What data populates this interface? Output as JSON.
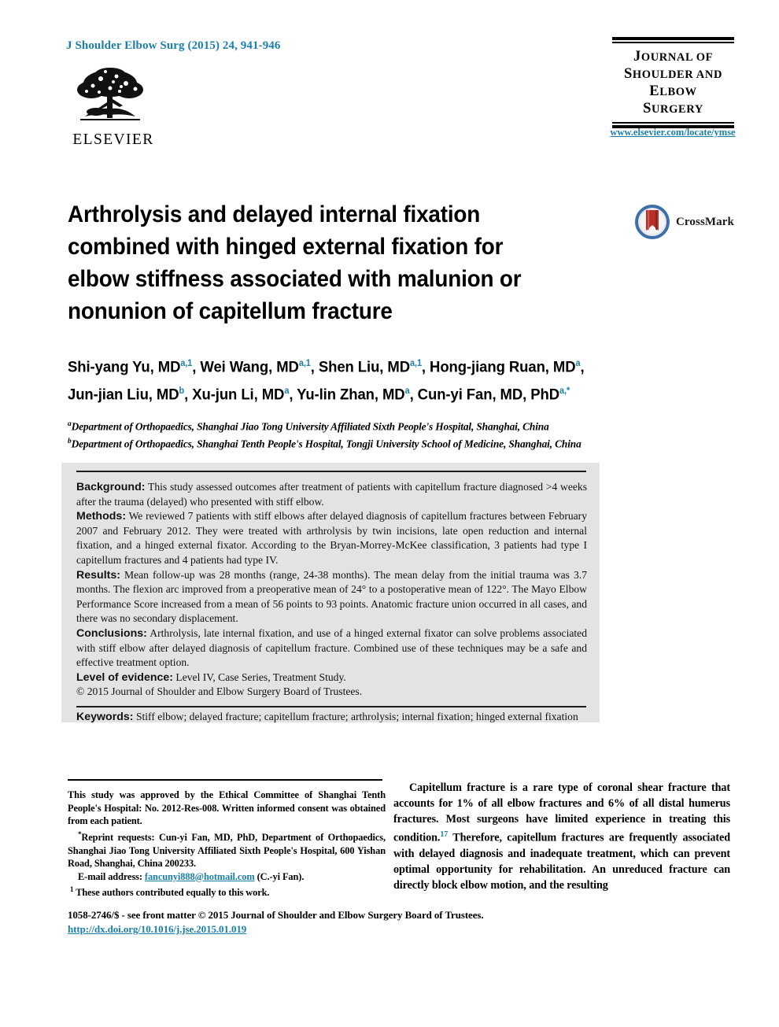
{
  "header": {
    "journal_reference": "J Shoulder Elbow Surg (2015) 24, 941-946",
    "publisher_name": "ELSEVIER",
    "publisher_logo": "elsevier-tree-logo",
    "masthead": {
      "line1_small": "OURNAL OF",
      "line1_cap": "J",
      "line2_cap": "S",
      "line2_small": "HOULDER AND",
      "line3_cap": "E",
      "line3_small": "LBOW",
      "line4_cap": "S",
      "line4_small": "URGERY"
    },
    "journal_url": "www.elsevier.com/locate/ymse"
  },
  "article": {
    "title": "Arthrolysis and delayed internal fixation combined with hinged external fixation for elbow stiffness associated with malunion or nonunion of capitellum fracture",
    "crossmark_label": "CrossMark",
    "authors_line1_html": "Shi-yang Yu, MD<sup>a,1</sup>, Wei Wang, MD<sup>a,1</sup>, Shen Liu, MD<sup>a,1</sup>, Hong-jiang Ruan, MD<sup>a</sup>,",
    "authors_line2_html": "Jun-jian Liu, MD<sup>b</sup>, Xu-jun Li, MD<sup>a</sup>, Yu-lin Zhan, MD<sup>a</sup>, Cun-yi Fan, MD, PhD<sup>a,</sup><sup>*</sup>",
    "affiliation_a": "Department of Orthopaedics, Shanghai Jiao Tong University Affiliated Sixth People's Hospital, Shanghai, China",
    "affiliation_b": "Department of Orthopaedics, Shanghai Tenth People's Hospital, Tongji University School of Medicine, Shanghai, China",
    "affiliation_a_marker": "a",
    "affiliation_b_marker": "b"
  },
  "abstract": {
    "background_label": "Background:",
    "background_text": "This study assessed outcomes after treatment of patients with capitellum fracture diagnosed >4 weeks after the trauma (delayed) who presented with stiff elbow.",
    "methods_label": "Methods:",
    "methods_text": "We reviewed 7 patients with stiff elbows after delayed diagnosis of capitellum fractures between February 2007 and February 2012. They were treated with arthrolysis by twin incisions, late open reduction and internal fixation, and a hinged external fixator. According to the Bryan-Morrey-McKee classification, 3 patients had type I capitellum fractures and 4 patients had type IV.",
    "results_label": "Results:",
    "results_text": "Mean follow-up was 28 months (range, 24-38 months). The mean delay from the initial trauma was 3.7 months. The flexion arc improved from a preoperative mean of 24° to a postoperative mean of 122°. The Mayo Elbow Performance Score increased from a mean of 56 points to 93 points. Anatomic fracture union occurred in all cases, and there was no secondary displacement.",
    "conclusions_label": "Conclusions:",
    "conclusions_text": "Arthrolysis, late internal fixation, and use of a hinged external fixator can solve problems associated with stiff elbow after delayed diagnosis of capitellum fracture. Combined use of these techniques may be a safe and effective treatment option.",
    "level_label": "Level of evidence:",
    "level_text": "Level IV, Case Series, Treatment Study.",
    "copyright": "© 2015 Journal of Shoulder and Elbow Surgery Board of Trustees.",
    "keywords_label": "Keywords:",
    "keywords_text": "Stiff elbow; delayed fracture; capitellum fracture; arthrolysis; internal fixation; hinged external fixation"
  },
  "footnotes": {
    "ethics": "This study was approved by the Ethical Committee of Shanghai Tenth People's Hospital: No. 2012-Res-008. Written informed consent was obtained from each patient.",
    "reprint_marker": "*",
    "reprint": "Reprint requests: Cun-yi Fan, MD, PhD, Department of Orthopaedics, Shanghai Jiao Tong University Affiliated Sixth People's Hospital, 600 Yishan Road, Shanghai, China 200233.",
    "email_label": "E-mail address:",
    "email_address": "fancunyi888@hotmail.com",
    "email_suffix": "(C.-yi Fan).",
    "equal_contrib_marker": "1",
    "equal_contrib": "These authors contributed equally to this work."
  },
  "body": {
    "intro_paragraph_html": "Capitellum fracture is a rare type of coronal shear fracture that accounts for 1% of all elbow fractures and 6% of all distal humerus fractures. Most surgeons have limited experience in treating this condition.<sup>17</sup> Therefore, capitellum fractures are frequently associated with delayed diagnosis and inadequate treatment, which can prevent optimal opportunity for rehabilitation. An unreduced fracture can directly block elbow motion, and the resulting"
  },
  "footer": {
    "issn_line": "1058-2746/$ - see front matter © 2015 Journal of Shoulder and Elbow Surgery Board of Trustees.",
    "doi": "http://dx.doi.org/10.1016/j.jse.2015.01.019"
  },
  "colors": {
    "accent_blue": "#1a7fa8",
    "abstract_bg": "#e3e3e3",
    "crossmark_blue": "#3d6fa8",
    "crossmark_red": "#b5302a"
  }
}
